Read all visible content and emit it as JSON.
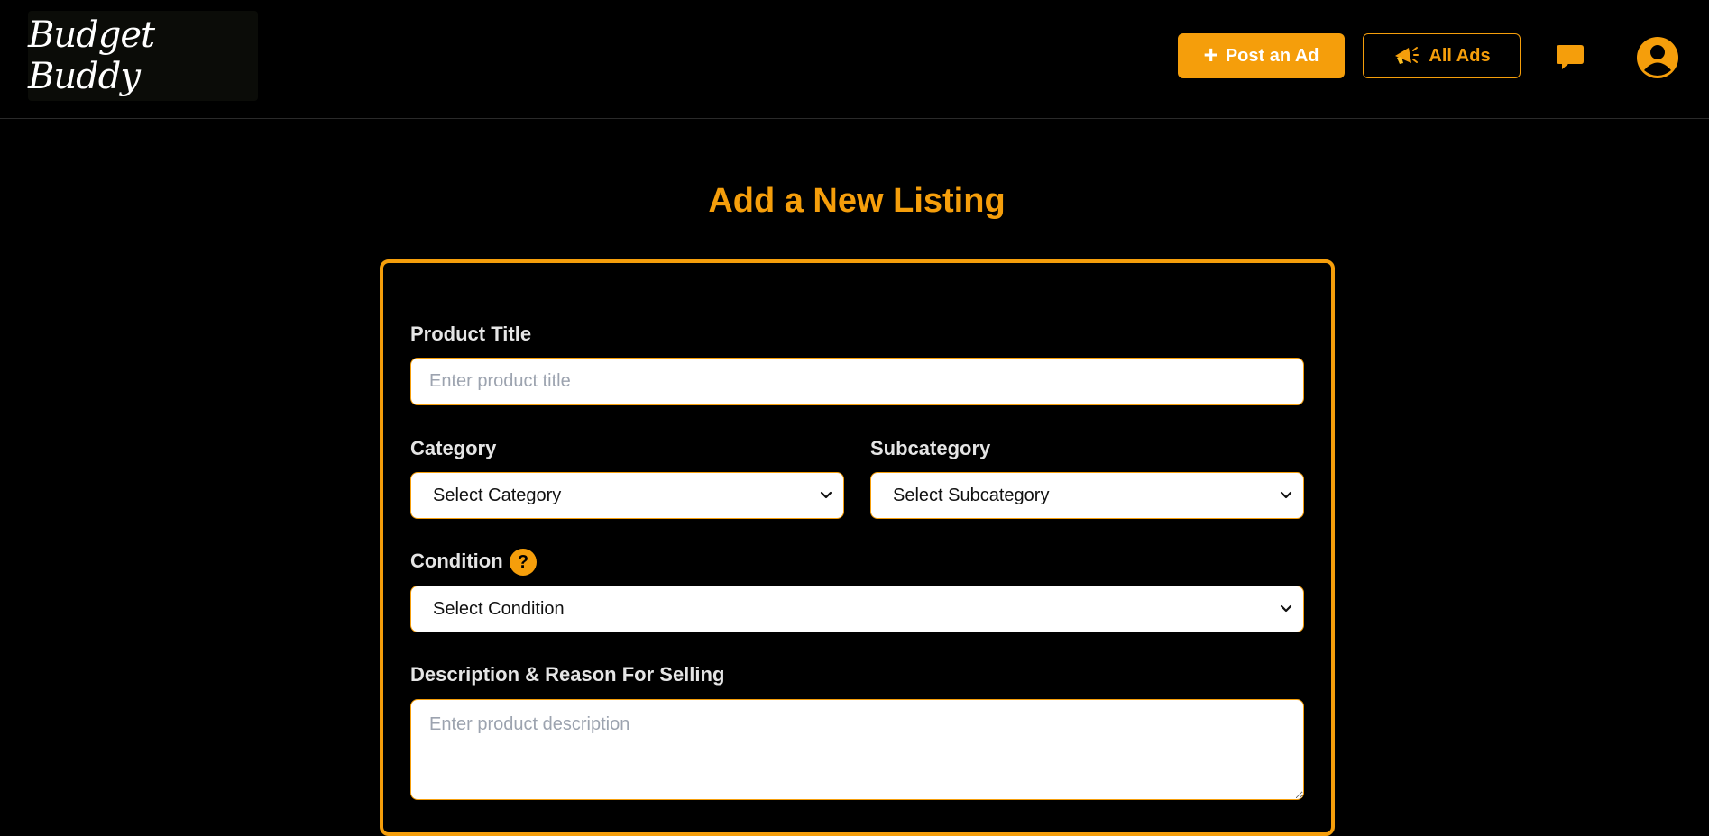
{
  "header": {
    "logo_text": "Budget Buddy",
    "post_ad_label": "Post an Ad",
    "all_ads_label": "All Ads"
  },
  "page": {
    "title": "Add a New Listing"
  },
  "form": {
    "product_title": {
      "label": "Product Title",
      "placeholder": "Enter product title",
      "value": ""
    },
    "category": {
      "label": "Category",
      "selected": "Select Category"
    },
    "subcategory": {
      "label": "Subcategory",
      "selected": "Select Subcategory"
    },
    "condition": {
      "label": "Condition",
      "help_glyph": "?",
      "selected": "Select Condition"
    },
    "description": {
      "label": "Description & Reason For Selling",
      "placeholder": "Enter product description",
      "value": ""
    }
  },
  "icons": {
    "plus": "plus-icon",
    "megaphone": "megaphone-icon",
    "chat": "chat-bubble-icon",
    "user": "user-account-icon",
    "chevron": "chevron-down-icon",
    "help": "help-icon"
  },
  "colors": {
    "accent": "#f59e0b",
    "background": "#000000",
    "label_text": "#e5e5e5",
    "input_bg": "#ffffff",
    "placeholder": "#9ca3af"
  }
}
